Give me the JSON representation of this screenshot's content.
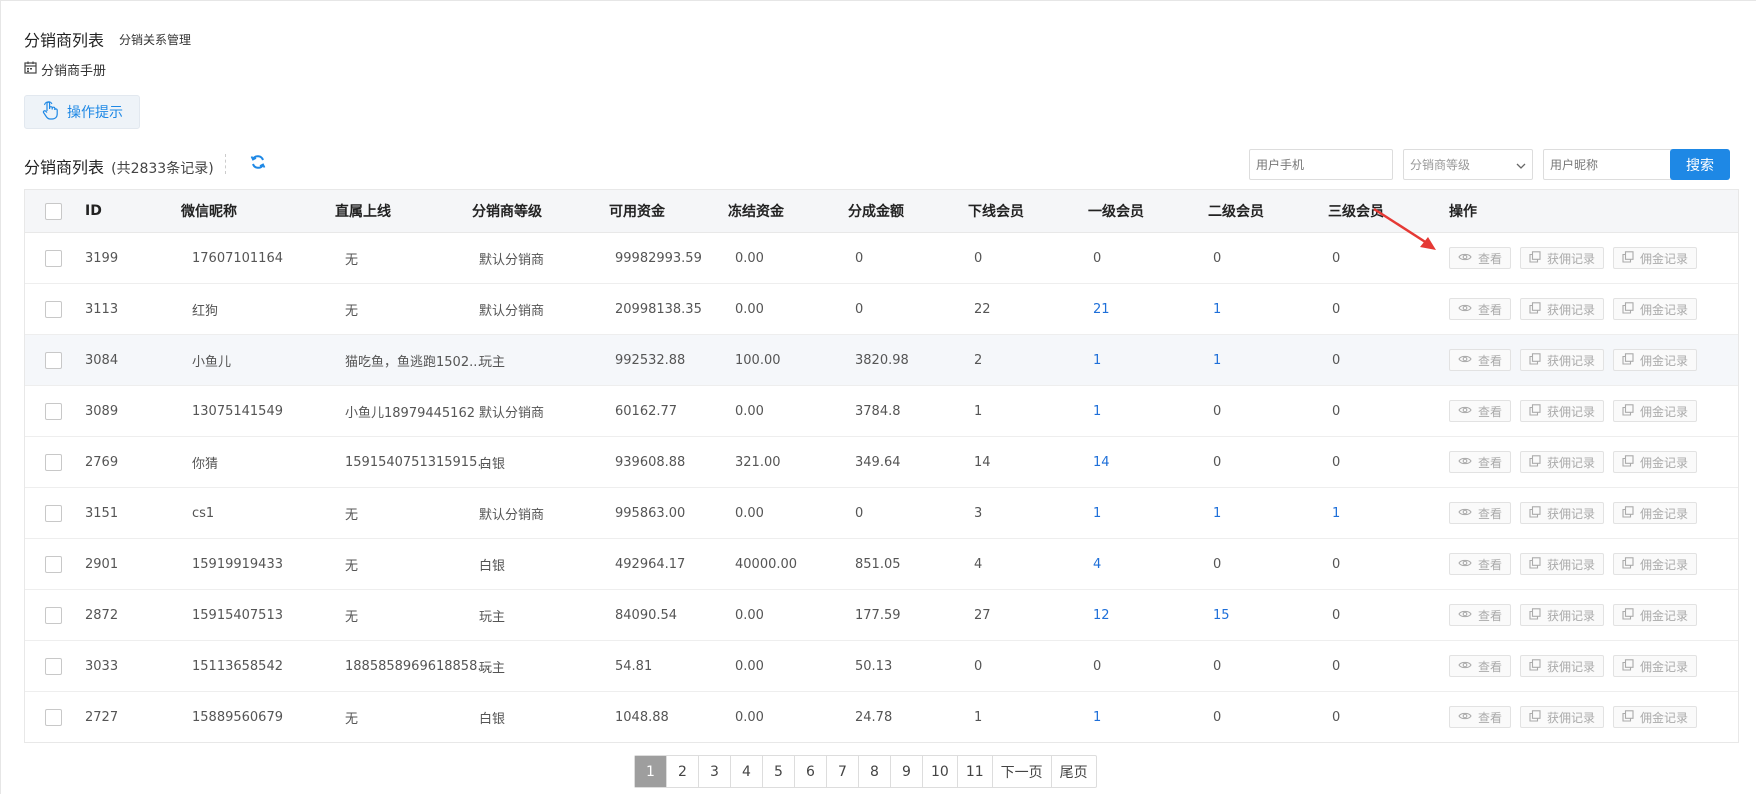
{
  "header": {
    "title": "分销商列表",
    "subtitle": "分销关系管理",
    "manual": "分销商手册",
    "tip_button": "操作提示"
  },
  "list": {
    "title": "分销商列表",
    "count_text": "(共2833条记录)"
  },
  "search": {
    "phone_placeholder": "用户手机",
    "level_select": "分销商等级",
    "nickname_placeholder": "用户昵称",
    "button": "搜索"
  },
  "table": {
    "columns": [
      "ID",
      "微信昵称",
      "直属上线",
      "分销商等级",
      "可用资金",
      "冻结资金",
      "分成金额",
      "下线会员",
      "一级会员",
      "二级会员",
      "三级会员",
      "操作"
    ],
    "ops": {
      "view": "查看",
      "earn": "获佣记录",
      "commission": "佣金记录"
    },
    "rows": [
      {
        "id": "3199",
        "nick": "17607101164",
        "parent": "无",
        "level": "默认分销商",
        "avail": "99982993.59",
        "frozen": "0.00",
        "share": "0",
        "down": "0",
        "l1": "0",
        "l2": "0",
        "l3": "0"
      },
      {
        "id": "3113",
        "nick": "红狗",
        "parent": "无",
        "level": "默认分销商",
        "avail": "20998138.35",
        "frozen": "0.00",
        "share": "0",
        "down": "22",
        "l1": "21",
        "l2": "1",
        "l3": "0"
      },
      {
        "id": "3084",
        "nick": "小鱼儿",
        "parent": "猫吃鱼，鱼逃跑1502...",
        "level": "玩主",
        "avail": "992532.88",
        "frozen": "100.00",
        "share": "3820.98",
        "down": "2",
        "l1": "1",
        "l2": "1",
        "l3": "0"
      },
      {
        "id": "3089",
        "nick": "13075141549",
        "parent": "小鱼儿18979445162",
        "level": "默认分销商",
        "avail": "60162.77",
        "frozen": "0.00",
        "share": "3784.8",
        "down": "1",
        "l1": "1",
        "l2": "0",
        "l3": "0"
      },
      {
        "id": "2769",
        "nick": "你猜",
        "parent": "1591540751315915...",
        "level": "白银",
        "avail": "939608.88",
        "frozen": "321.00",
        "share": "349.64",
        "down": "14",
        "l1": "14",
        "l2": "0",
        "l3": "0"
      },
      {
        "id": "3151",
        "nick": "cs1",
        "parent": "无",
        "level": "默认分销商",
        "avail": "995863.00",
        "frozen": "0.00",
        "share": "0",
        "down": "3",
        "l1": "1",
        "l2": "1",
        "l3": "1"
      },
      {
        "id": "2901",
        "nick": "15919919433",
        "parent": "无",
        "level": "白银",
        "avail": "492964.17",
        "frozen": "40000.00",
        "share": "851.05",
        "down": "4",
        "l1": "4",
        "l2": "0",
        "l3": "0"
      },
      {
        "id": "2872",
        "nick": "15915407513",
        "parent": "无",
        "level": "玩主",
        "avail": "84090.54",
        "frozen": "0.00",
        "share": "177.59",
        "down": "27",
        "l1": "12",
        "l2": "15",
        "l3": "0"
      },
      {
        "id": "3033",
        "nick": "15113658542",
        "parent": "1885858969618858...",
        "level": "玩主",
        "avail": "54.81",
        "frozen": "0.00",
        "share": "50.13",
        "down": "0",
        "l1": "0",
        "l2": "0",
        "l3": "0"
      },
      {
        "id": "2727",
        "nick": "15889560679",
        "parent": "无",
        "level": "白银",
        "avail": "1048.88",
        "frozen": "0.00",
        "share": "24.78",
        "down": "1",
        "l1": "1",
        "l2": "0",
        "l3": "0"
      }
    ]
  },
  "pagination": {
    "pages": [
      "1",
      "2",
      "3",
      "4",
      "5",
      "6",
      "7",
      "8",
      "9",
      "10",
      "11"
    ],
    "current": "1",
    "next": "下一页",
    "last": "尾页"
  },
  "colors": {
    "accent": "#1e88e5",
    "link": "#1e6fd9",
    "arrow": "#e53935",
    "pager_active": "#9e9e9e"
  }
}
